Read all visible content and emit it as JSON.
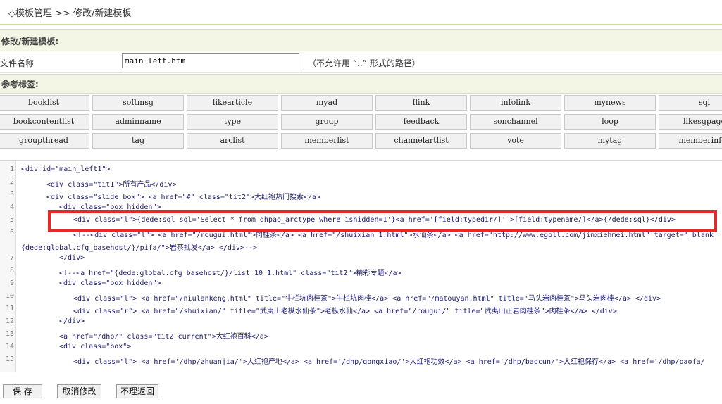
{
  "breadcrumb": "◇模板管理 >> 修改/新建模板",
  "section_title": "修改/新建模板:",
  "file_row": {
    "label": "文件名称",
    "value": "main_left.htm",
    "note": "（不允许用 “..” 形式的路径）"
  },
  "ref_title": "参考标签:",
  "tags": [
    [
      "booklist",
      "softmsg",
      "likearticle",
      "myad",
      "flink",
      "infolink",
      "mynews",
      "sql"
    ],
    [
      "bookcontentlist",
      "adminname",
      "type",
      "group",
      "feedback",
      "sonchannel",
      "loop",
      "likesgpage"
    ],
    [
      "groupthread",
      "tag",
      "arclist",
      "memberlist",
      "channelartlist",
      "vote",
      "mytag",
      "memberinfos"
    ]
  ],
  "code_lines": [
    {
      "n": "1",
      "t": "<div id=\"main_left1\">"
    },
    {
      "n": "2",
      "t": "<div class=\"tit1\">所有产品</div>"
    },
    {
      "n": "3",
      "t": "<div class=\"slide_box\"> <a href=\"#\" class=\"tit2\">大红袍热门搜索</a>"
    },
    {
      "n": "4",
      "t": "<div class=\"box hidden\">"
    },
    {
      "n": "5",
      "t": "<div class=\"l\">{dede:sql sql='Select * from dhpao_arctype where ishidden=1'}<a href='[field:typedir/]' >[field:typename/]</a>{/dede:sql}</div>"
    },
    {
      "n": "6",
      "t": "<!--<div class=\"l\"> <a href=\"/rougui.html\">肉桂茶</a> <a href=\"/shuixian_1.html\">水仙茶</a> <a href=\"http://www.egoll.com/jinxiehmei.html\" target=\"_blank"
    },
    {
      "n": "",
      "t": "{dede:global.cfg_basehost/}/pifa/\">岩茶批发</a> </div>-->"
    },
    {
      "n": "7",
      "t": "</div>"
    },
    {
      "n": "8",
      "t": "<!--<a href=\"{dede:global.cfg_basehost/}/list_10_1.html\" class=\"tit2\">精彩专题</a>"
    },
    {
      "n": "9",
      "t": "<div class=\"box hidden\">"
    },
    {
      "n": "10",
      "t": "<div class=\"l\"> <a href=\"/niulankeng.html\" title=\"牛栏坑肉桂茶\">牛栏坑肉桂</a> <a href=\"/matouyan.html\" title=\"马头岩肉桂茶\">马头岩肉桂</a> </div>"
    },
    {
      "n": "11",
      "t": "<div class=\"r\"> <a href=\"/shuixian/\" title=\"武夷山老枞水仙茶\">老枞水仙</a> <a href=\"/rougui/\" title=\"武夷山正岩肉桂茶\">肉桂茶</a> </div>"
    },
    {
      "n": "12",
      "t": "</div>"
    },
    {
      "n": "13",
      "t": "<a href=\"/dhp/\" class=\"tit2 current\">大红袍百科</a>"
    },
    {
      "n": "14",
      "t": "<div class=\"box\">"
    },
    {
      "n": "15",
      "t": "<div class=\"l\"> <a href='/dhp/zhuanjia/'>大红袍产地</a> <a href='/dhp/gongxiao/'>大红袍功效</a> <a href='/dhp/baocun/'>大红袍保存</a> <a href='/dhp/paofa/"
    }
  ],
  "buttons": {
    "save": "保 存",
    "cancel": "取消修改",
    "back": "不理返回"
  },
  "colors": {
    "highlight": "#e8272b",
    "bar_bg": "#f4f6e5"
  }
}
